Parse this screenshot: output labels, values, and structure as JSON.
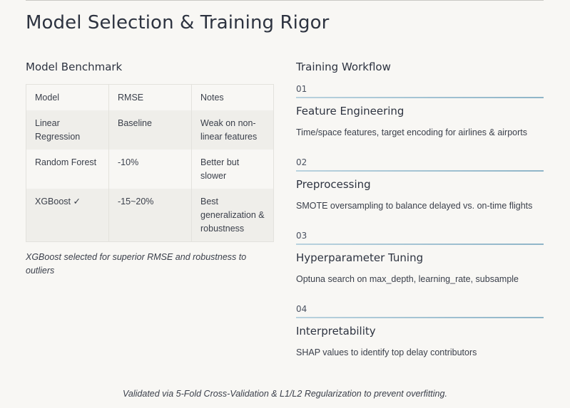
{
  "page": {
    "title": "Model Selection & Training Rigor"
  },
  "benchmark": {
    "heading": "Model Benchmark",
    "columns": [
      "Model",
      "RMSE",
      "Notes"
    ],
    "rows": [
      [
        "Linear Regression",
        "Baseline",
        "Weak on non-linear features"
      ],
      [
        "Random Forest",
        "-10%",
        "Better but slower"
      ],
      [
        "XGBoost ✓",
        "-15~20%",
        "Best generalization & robustness"
      ]
    ],
    "note": "XGBoost selected for superior RMSE and robustness to outliers"
  },
  "workflow": {
    "heading": "Training Workflow",
    "steps": [
      {
        "num": "01",
        "title": "Feature Engineering",
        "desc": "Time/space features, target encoding for airlines & airports"
      },
      {
        "num": "02",
        "title": "Preprocessing",
        "desc": "SMOTE oversampling to balance delayed vs. on-time flights"
      },
      {
        "num": "03",
        "title": "Hyperparameter Tuning",
        "desc": "Optuna search on max_depth, learning_rate, subsample"
      },
      {
        "num": "04",
        "title": "Interpretability",
        "desc": "SHAP values to identify top delay contributors"
      }
    ]
  },
  "footer": {
    "note": "Validated via 5-Fold Cross-Validation & L1/L2 Regularization to prevent overfitting."
  },
  "colors": {
    "background": "#f8f7f4",
    "text": "#2d3340",
    "shaded_row": "#efeeea",
    "accent_rule": "#8fb5c8"
  }
}
